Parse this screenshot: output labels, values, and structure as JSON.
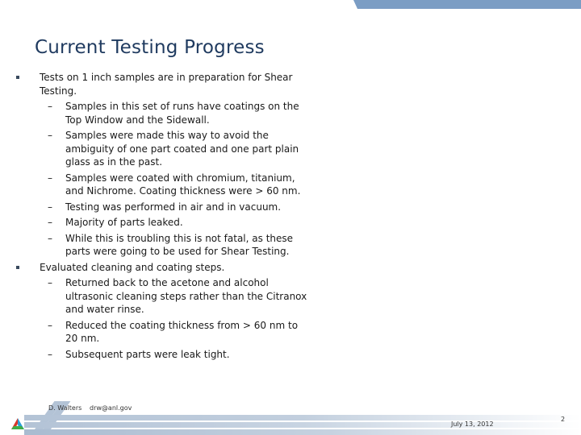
{
  "colors": {
    "banner": "#7b9dc4",
    "title": "#1f3a5f",
    "footer_band": "#b3c3d6"
  },
  "slide": {
    "title": "Current Testing Progress",
    "bullets": [
      {
        "text": "Tests on 1 inch samples are in preparation for Shear Testing.",
        "subitems": [
          "Samples in this set of runs have coatings on the Top Window and the Sidewall.",
          "Samples were made this way to avoid the ambiguity of one part coated and one part plain glass as in the past.",
          "Samples were coated with chromium, titanium, and Nichrome.  Coating thickness were > 60 nm.",
          "Testing was performed in air and in vacuum.",
          "Majority of parts leaked.",
          "While this is troubling this is not fatal, as these parts were going to be used for Shear Testing."
        ]
      },
      {
        "text": "Evaluated cleaning and coating steps.",
        "subitems": [
          "Returned back to the acetone and alcohol ultrasonic cleaning steps rather than the Citranox and water rinse.",
          "Reduced the coating thickness from > 60 nm to 20 nm.",
          "Subsequent parts were leak tight."
        ]
      }
    ],
    "bullet_glyph": "square-bullet",
    "dash_glyph": "–"
  },
  "footer": {
    "author": "D. Walters",
    "email": "drw@anl.gov",
    "date": "July 13, 2012",
    "page_number": "2",
    "logo": "argonne-logo-icon"
  }
}
